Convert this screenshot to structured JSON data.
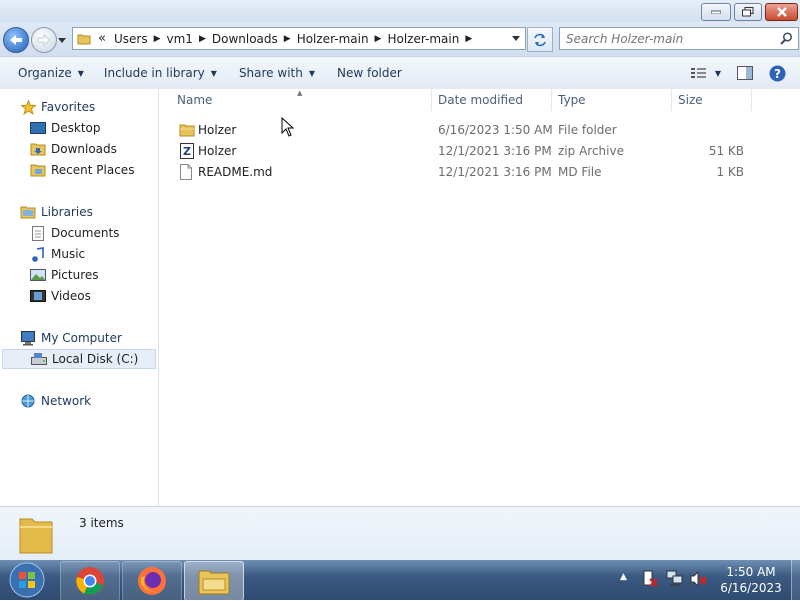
{
  "window": {
    "minimize_icon": "minimize-icon",
    "maximize_icon": "maximize-icon",
    "close_icon": "close-icon"
  },
  "address": {
    "overflow": "«",
    "crumbs": [
      "Users",
      "vm1",
      "Downloads",
      "Holzer-main",
      "Holzer-main"
    ],
    "search_placeholder": "Search Holzer-main"
  },
  "toolbar": {
    "organize": "Organize",
    "include_in_library": "Include in library",
    "share_with": "Share with",
    "new_folder": "New folder"
  },
  "nav": {
    "favorites": "Favorites",
    "desktop": "Desktop",
    "downloads": "Downloads",
    "recent_places": "Recent Places",
    "libraries": "Libraries",
    "documents": "Documents",
    "music": "Music",
    "pictures": "Pictures",
    "videos": "Videos",
    "my_computer": "My Computer",
    "local_disk": "Local Disk (C:)",
    "network": "Network"
  },
  "columns": {
    "name": "Name",
    "date_modified": "Date modified",
    "type": "Type",
    "size": "Size"
  },
  "files": [
    {
      "name": "Holzer",
      "date": "6/16/2023 1:50 AM",
      "type": "File folder",
      "size": "",
      "icon": "folder-icon"
    },
    {
      "name": "Holzer",
      "date": "12/1/2021 3:16 PM",
      "type": "zip Archive",
      "size": "51 KB",
      "icon": "zip-archive-icon"
    },
    {
      "name": "README.md",
      "date": "12/1/2021 3:16 PM",
      "type": "MD File",
      "size": "1 KB",
      "icon": "document-icon"
    }
  ],
  "details": {
    "item_count": "3 items"
  },
  "clock": {
    "time": "1:50 AM",
    "date": "6/16/2023"
  },
  "colors": {
    "accent": "#1e395b",
    "selection": "#e5eef9",
    "taskbar": "#3b5a82"
  }
}
